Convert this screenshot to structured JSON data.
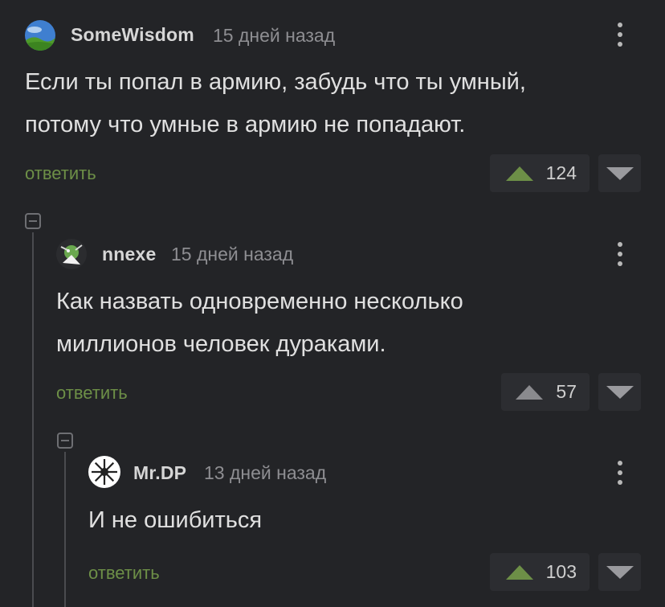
{
  "comments": [
    {
      "username": "SomeWisdom",
      "time": "15 дней назад",
      "text_lines": [
        "Если ты попал в армию, забудь что ты умный,",
        "потому что умные в армию не попадают."
      ],
      "reply_label": "ответить",
      "score": "124",
      "upvote_color": "#6d8f47"
    },
    {
      "username": "nnexe",
      "time": "15 дней назад",
      "text_lines": [
        "Как назвать одновременно несколько",
        "миллионов человек дураками."
      ],
      "reply_label": "ответить",
      "score": "57",
      "upvote_color": "#8a8a8e"
    },
    {
      "username": "Mr.DP",
      "time": "13 дней назад",
      "text_lines": [
        "И не ошибиться"
      ],
      "reply_label": "ответить",
      "score": "103",
      "upvote_color": "#6d8f47"
    }
  ],
  "icons": {
    "more": "vertical-dots-icon",
    "upvote": "triangle-up-icon",
    "downvote": "triangle-down-icon",
    "collapse": "minus-box-icon"
  }
}
